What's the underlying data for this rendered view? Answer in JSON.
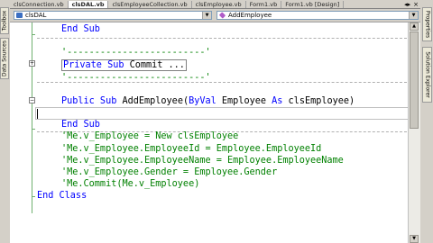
{
  "tabs": [
    {
      "label": "clsConnection.vb",
      "active": false
    },
    {
      "label": "clsDAL.vb",
      "active": true
    },
    {
      "label": "clsEmployeeCollection.vb",
      "active": false
    },
    {
      "label": "clsEmployee.vb",
      "active": false
    },
    {
      "label": "Form1.vb",
      "active": false
    },
    {
      "label": "Form1.vb [Design]",
      "active": false
    }
  ],
  "tab_controls": {
    "scroll": "◂▸",
    "close": "×"
  },
  "side_left": {
    "toolbox": "Toolbox",
    "data_sources": "Data Sources"
  },
  "side_right": {
    "properties": "Properties",
    "solution_explorer": "Solution Explorer"
  },
  "class_dropdown": {
    "value": "clsDAL"
  },
  "method_dropdown": {
    "value": "AddEmployee"
  },
  "code": {
    "end_sub_1": "End Sub",
    "comment_line_1": "'-------------------------'",
    "private_sub": "Private Sub",
    "commit_name": "Commit ...",
    "comment_line_2": "'-------------------------'",
    "public_sub": "Public Sub",
    "add_employee": "AddEmployee(",
    "byval": "ByVal",
    "param": "Employee",
    "as": "As",
    "param_type": "clsEmployee)",
    "end_sub_2": "End Sub",
    "c1": "'Me.v_Employee = New clsEmployee",
    "c2": "'Me.v_Employee.EmployeeId = Employee.EmployeeId",
    "c3": "'Me.v_Employee.EmployeeName = Employee.EmployeeName",
    "c4": "'Me.v_Employee.Gender = Employee.Gender",
    "c5": "'Me.Commit(Me.v_Employee)",
    "end_class": "End Class"
  },
  "colors": {
    "keyword": "#0000ff",
    "comment": "#008000",
    "text": "#000000",
    "outline": "#70b070"
  }
}
